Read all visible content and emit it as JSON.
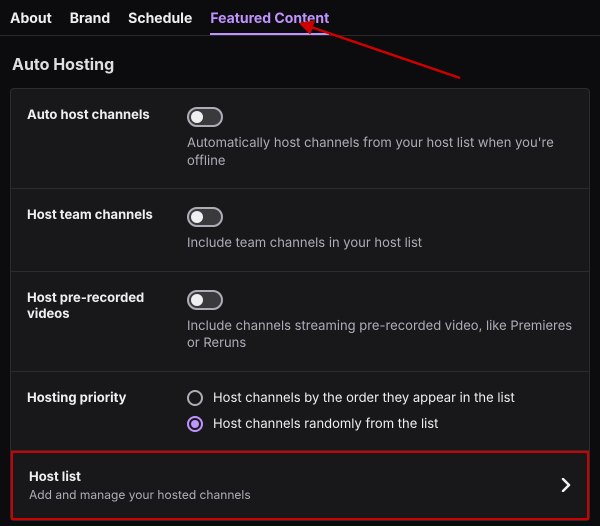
{
  "tabs": {
    "about": "About",
    "brand": "Brand",
    "schedule": "Schedule",
    "featured": "Featured Content"
  },
  "section_title": "Auto Hosting",
  "rows": {
    "auto_host": {
      "label": "Auto host channels",
      "desc": "Automatically host channels from your host list when you're offline"
    },
    "host_team": {
      "label": "Host team channels",
      "desc": "Include team channels in your host list"
    },
    "pre_recorded": {
      "label": "Host pre-recorded videos",
      "desc": "Include channels streaming pre-recorded video, like Premieres or Reruns"
    },
    "priority": {
      "label": "Hosting priority",
      "option_order": "Host channels by the order they appear in the list",
      "option_random": "Host channels randomly from the list"
    }
  },
  "host_list": {
    "title": "Host list",
    "sub": "Add and manage your hosted channels"
  }
}
